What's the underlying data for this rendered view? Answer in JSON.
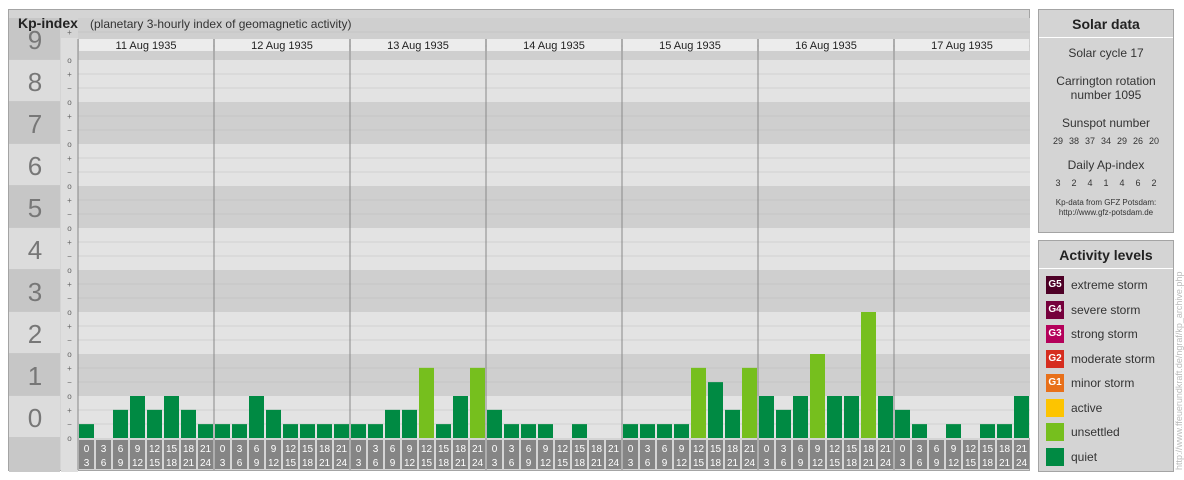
{
  "header": {
    "title": "Kp-index",
    "subtitle": "(planetary 3-hourly index of geomagnetic activity)"
  },
  "solar_data": {
    "title": "Solar data",
    "solar_cycle": "Solar cycle 17",
    "carrington_line1": "Carrington rotation",
    "carrington_line2": "number 1095",
    "sunspot_label": "Sunspot number",
    "sunspot_numbers": [
      "29",
      "38",
      "37",
      "34",
      "29",
      "26",
      "20"
    ],
    "ap_label": "Daily Ap-index",
    "ap_values": [
      "3",
      "2",
      "4",
      "1",
      "4",
      "6",
      "2"
    ],
    "source_line1": "Kp-data from GFZ Potsdam:",
    "source_line2": "http://www.gfz-potsdam.de"
  },
  "activity_levels": {
    "title": "Activity levels",
    "items": [
      {
        "badge": "G5",
        "label": "extreme storm",
        "color": "#4d0026"
      },
      {
        "badge": "G4",
        "label": "severe storm",
        "color": "#75003c"
      },
      {
        "badge": "G3",
        "label": "strong storm",
        "color": "#b4005a"
      },
      {
        "badge": "G2",
        "label": "moderate storm",
        "color": "#d62d1f"
      },
      {
        "badge": "G1",
        "label": "minor storm",
        "color": "#e8701a"
      },
      {
        "badge": "",
        "label": "active",
        "color": "#fdc400"
      },
      {
        "badge": "",
        "label": "unsettled",
        "color": "#76bf1e"
      },
      {
        "badge": "",
        "label": "quiet",
        "color": "#008a43"
      }
    ]
  },
  "watermark": "http://www.ffeuerundkraft.de/ngraf/kp_archive.php",
  "chart_data": {
    "type": "bar",
    "y_axis_major_labels": [
      "0",
      "1",
      "2",
      "3",
      "4",
      "5",
      "6",
      "7",
      "8",
      "9"
    ],
    "y_axis_minor_labels": [
      "+",
      "o",
      "−"
    ],
    "ylim": [
      0,
      9
    ],
    "days": [
      "11 Aug 1935",
      "12 Aug 1935",
      "13 Aug 1935",
      "14 Aug 1935",
      "15 Aug 1935",
      "16 Aug 1935",
      "17 Aug 1935"
    ],
    "interval_start_hours": [
      "0",
      "3",
      "6",
      "9",
      "12",
      "15",
      "18",
      "21"
    ],
    "interval_end_hours": [
      "3",
      "6",
      "9",
      "12",
      "15",
      "18",
      "21",
      "24"
    ],
    "kp_values": [
      [
        0.33,
        0.0,
        0.67,
        1.0,
        0.67,
        1.0,
        0.67,
        0.33
      ],
      [
        0.33,
        0.33,
        1.0,
        0.67,
        0.33,
        0.33,
        0.33,
        0.33
      ],
      [
        0.33,
        0.33,
        0.67,
        0.67,
        1.67,
        0.33,
        1.0,
        1.67
      ],
      [
        0.67,
        0.33,
        0.33,
        0.33,
        0.0,
        0.33,
        0.0,
        0.0
      ],
      [
        0.33,
        0.33,
        0.33,
        0.33,
        1.67,
        1.33,
        0.67,
        1.67
      ],
      [
        1.0,
        0.67,
        1.0,
        2.0,
        1.0,
        1.0,
        3.0,
        1.0
      ],
      [
        0.67,
        0.33,
        0.0,
        0.33,
        0.0,
        0.33,
        0.33,
        1.0
      ]
    ],
    "level_thresholds": {
      "unsettled": 1.67,
      "active": 4,
      "storm": 5
    },
    "bar_colors": {
      "quiet": "#008a43",
      "unsettled": "#76bf1e",
      "active": "#fdc400"
    }
  }
}
